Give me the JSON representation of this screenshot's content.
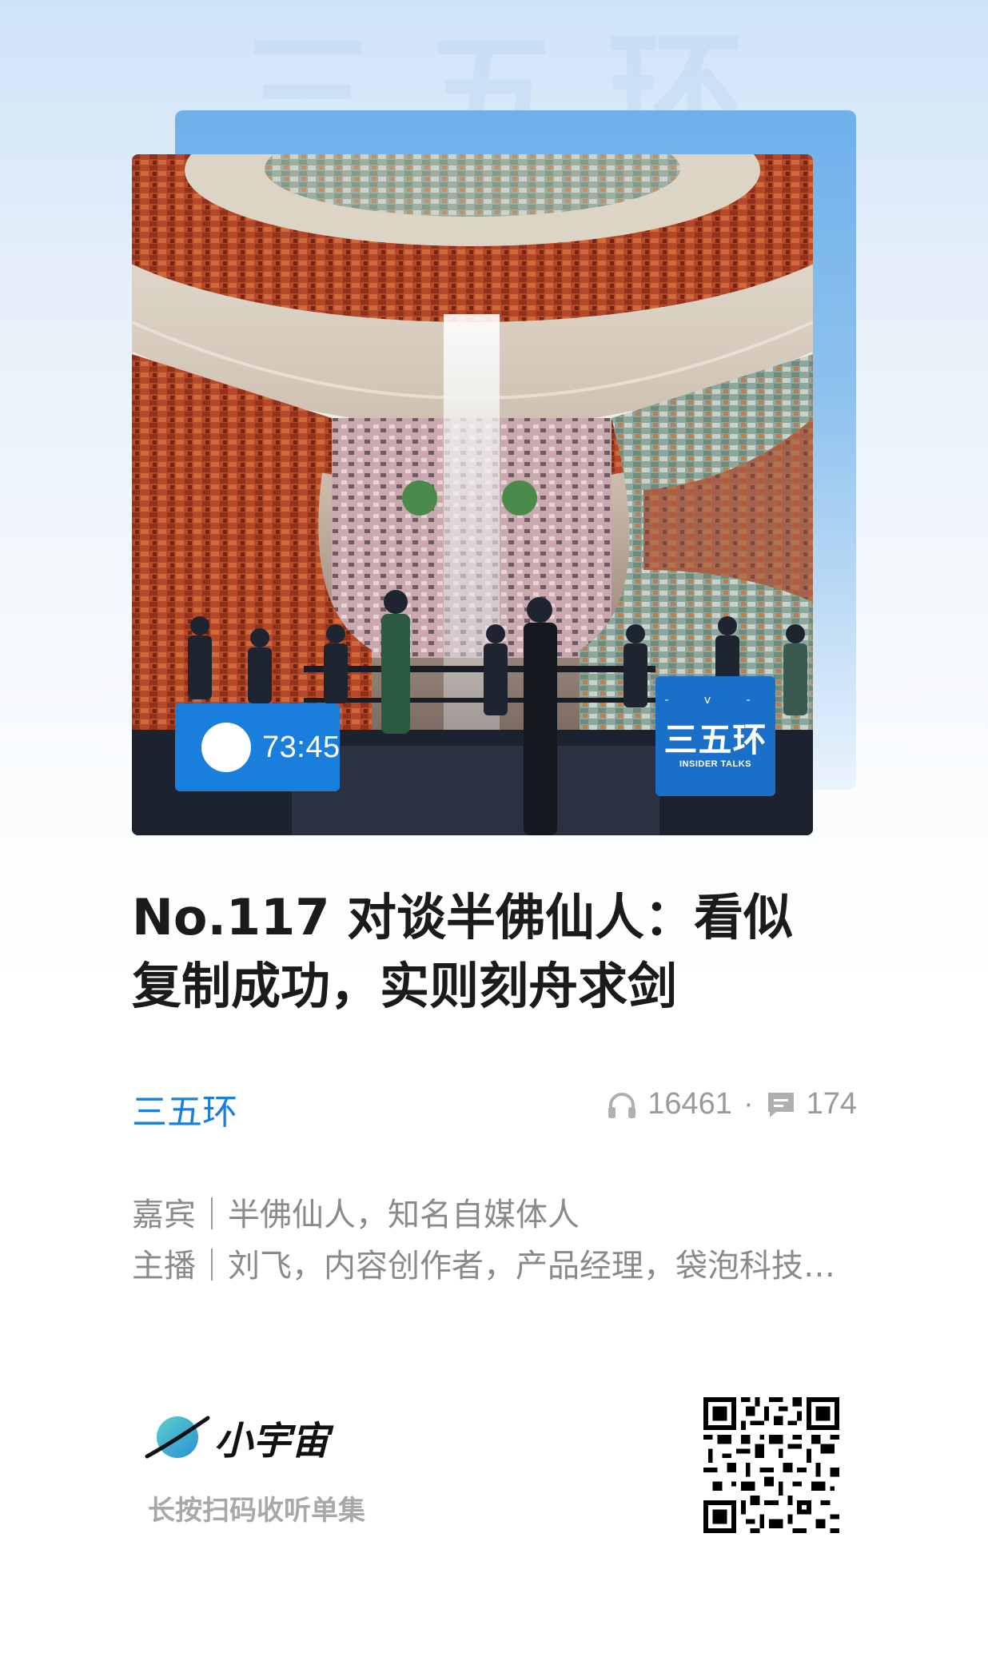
{
  "watermark": "三五环",
  "player": {
    "duration": "73:45"
  },
  "podcast_logo": {
    "name": "三五环",
    "subtitle": "INSIDER TALKS",
    "marks": "- v -"
  },
  "episode": {
    "title_line1": "No.117 对谈半佛仙人：看似",
    "title_line2": "复制成功，实则刻舟求剑"
  },
  "channel": "三五环",
  "stats": {
    "plays": "16461",
    "separator": "·",
    "comments": "174"
  },
  "meta": {
    "guest": "嘉宾｜半佛仙人，知名自媒体人",
    "host": "主播｜刘飞，内容创作者，产品经理，袋泡科技联合创始人"
  },
  "footer": {
    "brand": "小宇宙",
    "scan_hint": "长按扫码收听单集"
  },
  "colors": {
    "accent": "#1a7fdc",
    "title": "#1b1b1b",
    "muted": "#8a8a8a"
  }
}
